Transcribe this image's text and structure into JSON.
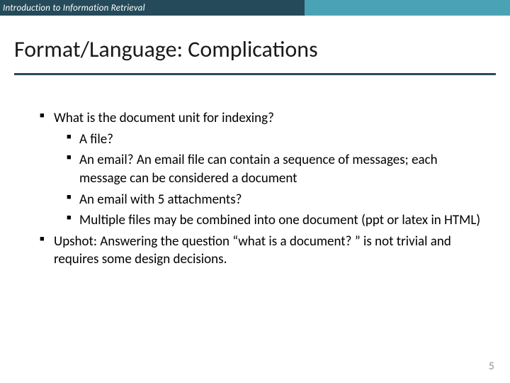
{
  "header": {
    "course": "Introduction to Information Retrieval"
  },
  "title": "Format/Language: Complications",
  "bullets": {
    "b1": "What is the document unit for indexing?",
    "b1a": "A file?",
    "b1b": "An email? An email file can contain a sequence of messages; each message can be considered a document",
    "b1c": "An email with 5 attachments?",
    "b1d": "Multiple files may be combined into one document (ppt or latex in HTML)",
    "b2": "Upshot: Answering the question “what is a document? ” is not trivial and requires some design decisions."
  },
  "page": "5"
}
